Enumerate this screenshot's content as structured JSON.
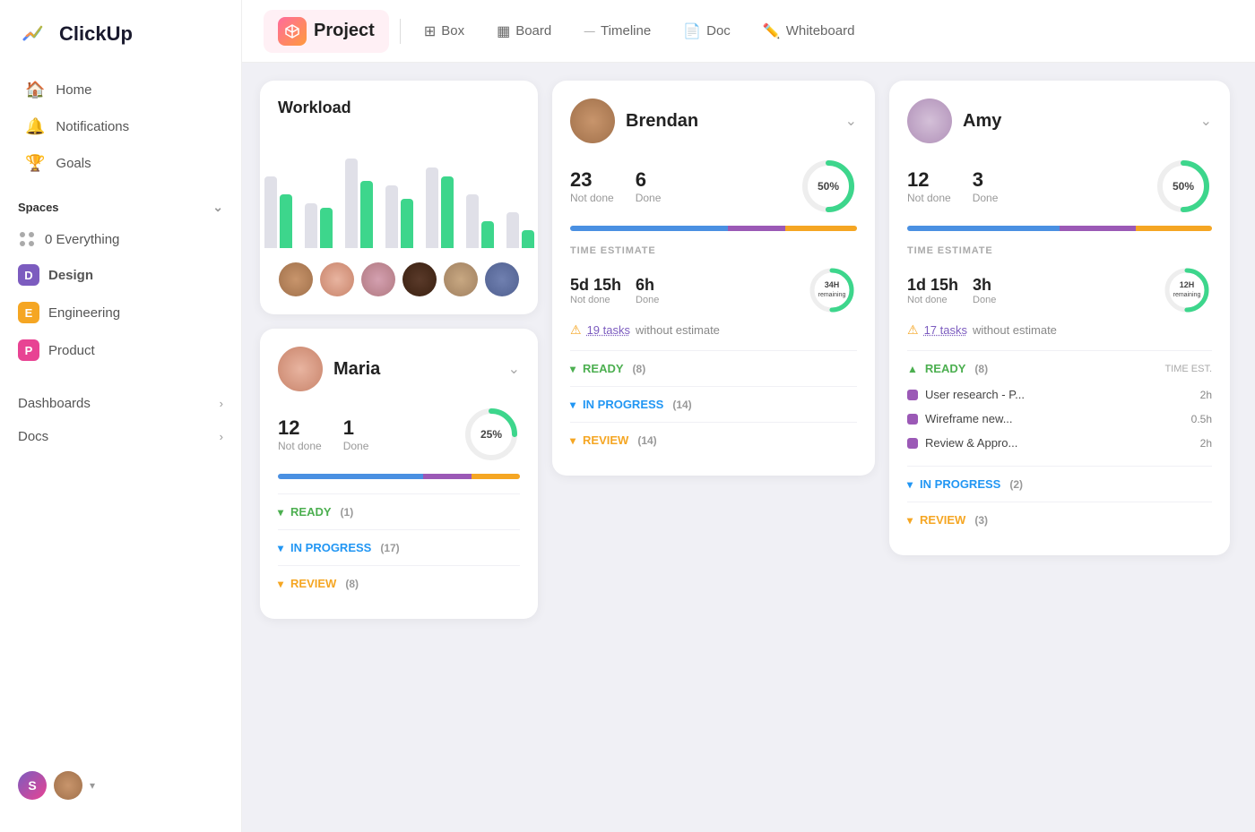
{
  "sidebar": {
    "logo_text": "ClickUp",
    "nav_items": [
      {
        "label": "Home",
        "icon": "🏠"
      },
      {
        "label": "Notifications",
        "icon": "🔔"
      },
      {
        "label": "Goals",
        "icon": "🏆"
      }
    ],
    "spaces_label": "Spaces",
    "spaces_chevron": "⌄",
    "space_items": [
      {
        "label": "Everything",
        "badge": null,
        "count": "0"
      },
      {
        "label": "Design",
        "badge": "D",
        "badge_class": "badge-d"
      },
      {
        "label": "Engineering",
        "badge": "E",
        "badge_class": "badge-e"
      },
      {
        "label": "Product",
        "badge": "P",
        "badge_class": "badge-p"
      }
    ],
    "links": [
      {
        "label": "Dashboards"
      },
      {
        "label": "Docs"
      }
    ],
    "bottom_initial": "S"
  },
  "topnav": {
    "project_label": "Project",
    "tabs": [
      {
        "label": "Box",
        "icon": "⊞"
      },
      {
        "label": "Board",
        "icon": "📋"
      },
      {
        "label": "Timeline",
        "icon": "—"
      },
      {
        "label": "Doc",
        "icon": "📄"
      },
      {
        "label": "Whiteboard",
        "icon": "✏️"
      }
    ]
  },
  "workload": {
    "title": "Workload",
    "bars": [
      {
        "gray": 80,
        "green": 60
      },
      {
        "gray": 50,
        "green": 45
      },
      {
        "gray": 100,
        "green": 75
      },
      {
        "gray": 70,
        "green": 55
      },
      {
        "gray": 90,
        "green": 80
      },
      {
        "gray": 60,
        "green": 30
      },
      {
        "gray": 40,
        "green": 20
      }
    ],
    "avatars": [
      "av1",
      "av2",
      "av3",
      "av4",
      "av5",
      "av6"
    ]
  },
  "brendan": {
    "name": "Brendan",
    "not_done": 23,
    "not_done_label": "Not done",
    "done": 6,
    "done_label": "Done",
    "percent": "50%",
    "progress_pct": 50,
    "time_estimate_label": "TIME ESTIMATE",
    "not_done_time": "5d 15h",
    "done_time": "6h",
    "remaining": "34H",
    "remaining_sub": "remaining",
    "warning_text": "19 tasks",
    "warning_suffix": "without estimate",
    "statuses": [
      {
        "label": "READY",
        "count": "(8)",
        "color": "status-dot-ready",
        "open": false
      },
      {
        "label": "IN PROGRESS",
        "count": "(14)",
        "color": "status-dot-progress",
        "open": false
      },
      {
        "label": "REVIEW",
        "count": "(14)",
        "color": "status-dot-review",
        "open": false
      }
    ]
  },
  "maria": {
    "name": "Maria",
    "not_done": 12,
    "not_done_label": "Not done",
    "done": 1,
    "done_label": "Done",
    "percent": "25%",
    "progress_pct": 25,
    "statuses": [
      {
        "label": "READY",
        "count": "(1)",
        "color": "status-dot-ready"
      },
      {
        "label": "IN PROGRESS",
        "count": "(17)",
        "color": "status-dot-progress"
      },
      {
        "label": "REVIEW",
        "count": "(8)",
        "color": "status-dot-review"
      }
    ]
  },
  "amy": {
    "name": "Amy",
    "not_done": 12,
    "not_done_label": "Not done",
    "done": 3,
    "done_label": "Done",
    "percent": "50%",
    "progress_pct": 50,
    "time_estimate_label": "TIME ESTIMATE",
    "not_done_time": "1d 15h",
    "done_time": "3h",
    "remaining": "12H",
    "remaining_sub": "remaining",
    "warning_text": "17 tasks",
    "warning_suffix": "without estimate",
    "statuses_label_time": "TIME EST.",
    "statuses": [
      {
        "label": "READY",
        "count": "(8)",
        "color": "status-dot-ready",
        "show_time_col": true
      },
      {
        "label": "IN PROGRESS",
        "count": "(2)",
        "color": "status-dot-progress"
      },
      {
        "label": "REVIEW",
        "count": "(3)",
        "color": "status-dot-review"
      }
    ],
    "tasks": [
      {
        "name": "User research - P...",
        "time": "2h",
        "color": "#9b59b6"
      },
      {
        "name": "Wireframe new...",
        "time": "0.5h",
        "color": "#9b59b6"
      },
      {
        "name": "Review & Appro...",
        "time": "2h",
        "color": "#9b59b6"
      }
    ]
  }
}
